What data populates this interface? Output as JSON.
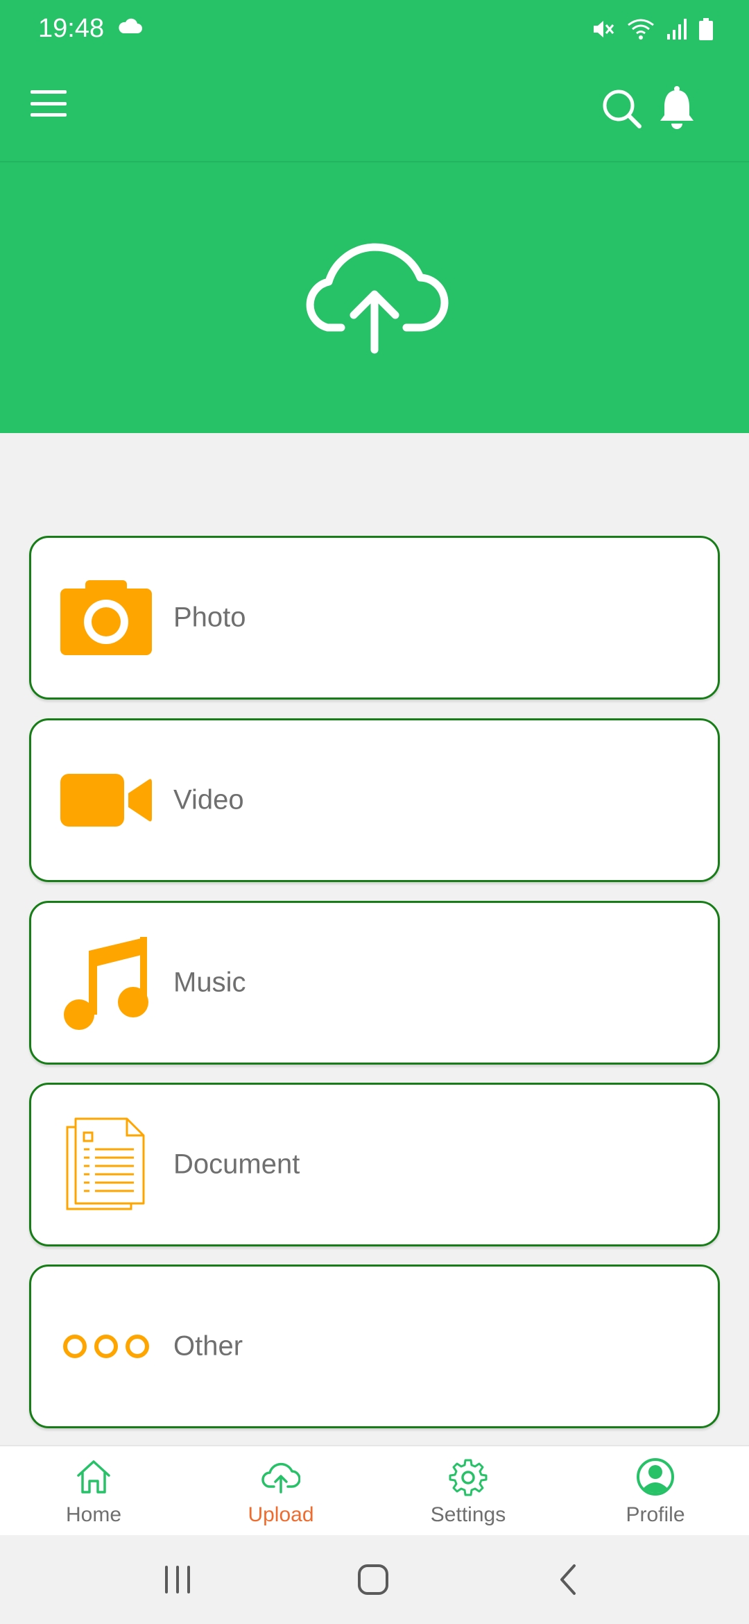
{
  "status_bar": {
    "time": "19:48"
  },
  "app_bar": {
    "menu_icon": "hamburger-icon",
    "search_icon": "search-icon",
    "bell_icon": "bell-icon"
  },
  "hero": {
    "icon": "cloud-upload-icon"
  },
  "upload_options": [
    {
      "label": "Photo",
      "icon": "camera-icon"
    },
    {
      "label": "Video",
      "icon": "video-camera-icon"
    },
    {
      "label": "Music",
      "icon": "music-note-icon"
    },
    {
      "label": "Document",
      "icon": "document-icon"
    },
    {
      "label": "Other",
      "icon": "more-dots-icon"
    }
  ],
  "bottom_nav": {
    "items": [
      {
        "label": "Home",
        "icon": "home-icon"
      },
      {
        "label": "Upload",
        "icon": "cloud-upload-icon",
        "active": true
      },
      {
        "label": "Settings",
        "icon": "gear-icon"
      },
      {
        "label": "Profile",
        "icon": "profile-icon"
      }
    ]
  },
  "colors": {
    "primary_green": "#27c168",
    "card_border": "#167d17",
    "icon_orange": "#ffa500",
    "active_tab": "#ee6c2e",
    "label_gray": "#6f6f6f"
  }
}
